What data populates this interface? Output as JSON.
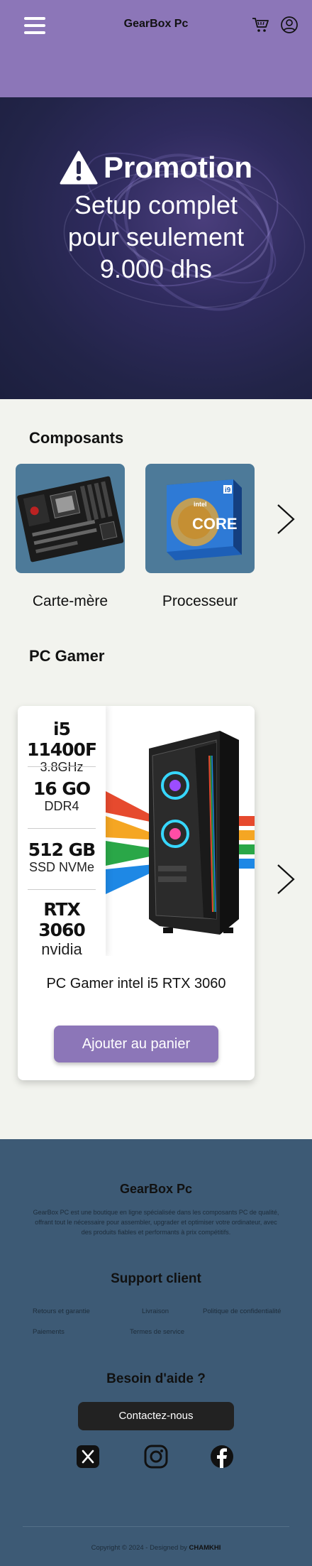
{
  "header": {
    "brand": "GearBox Pc",
    "icons": [
      "menu-icon",
      "cart-icon",
      "user-icon"
    ],
    "color": "#8c76b8"
  },
  "hero": {
    "title": "Promotion",
    "line1": "Setup complet",
    "line2": "pour seulement",
    "line3": "9.000 dhs"
  },
  "components": {
    "title": "Composants",
    "items": [
      {
        "label": "Carte-mère",
        "icon": "motherboard-image"
      },
      {
        "label": "Processeur",
        "icon": "intel-core-box-image"
      }
    ]
  },
  "pc_gamer": {
    "title": "PC Gamer",
    "specs": [
      {
        "main": "i5 11400F",
        "sub": "3.8GHz"
      },
      {
        "main": "16 GO",
        "sub": "DDR4"
      },
      {
        "main": "512 GB",
        "sub": "SSD NVMe"
      },
      {
        "main": "RTX 3060",
        "sub": "nvidia"
      }
    ],
    "product_name": "PC Gamer intel i5 RTX 3060",
    "add_button": "Ajouter au panier"
  },
  "footer": {
    "brand": "GearBox Pc",
    "description": "GearBox PC est une boutique en ligne spécialisée dans les composants PC de qualité, offrant tout le nécessaire pour assembler, upgrader et optimiser votre ordinateur, avec des produits fiables et performants à prix compétitifs.",
    "support_title": "Support client",
    "links": {
      "returns": "Retours et garantie",
      "delivery": "Livraison",
      "privacy": "Politique de confidentialité",
      "payments": "Paiements",
      "terms": "Termes de service"
    },
    "help_title": "Besoin d'aide ?",
    "contact_button": "Contactez-nous",
    "social": [
      "x-icon",
      "instagram-icon",
      "facebook-icon"
    ],
    "copyright_prefix": "Copyright © 2024 - Designed by",
    "designer": "CHAMKHI",
    "color": "#3d5a75"
  }
}
